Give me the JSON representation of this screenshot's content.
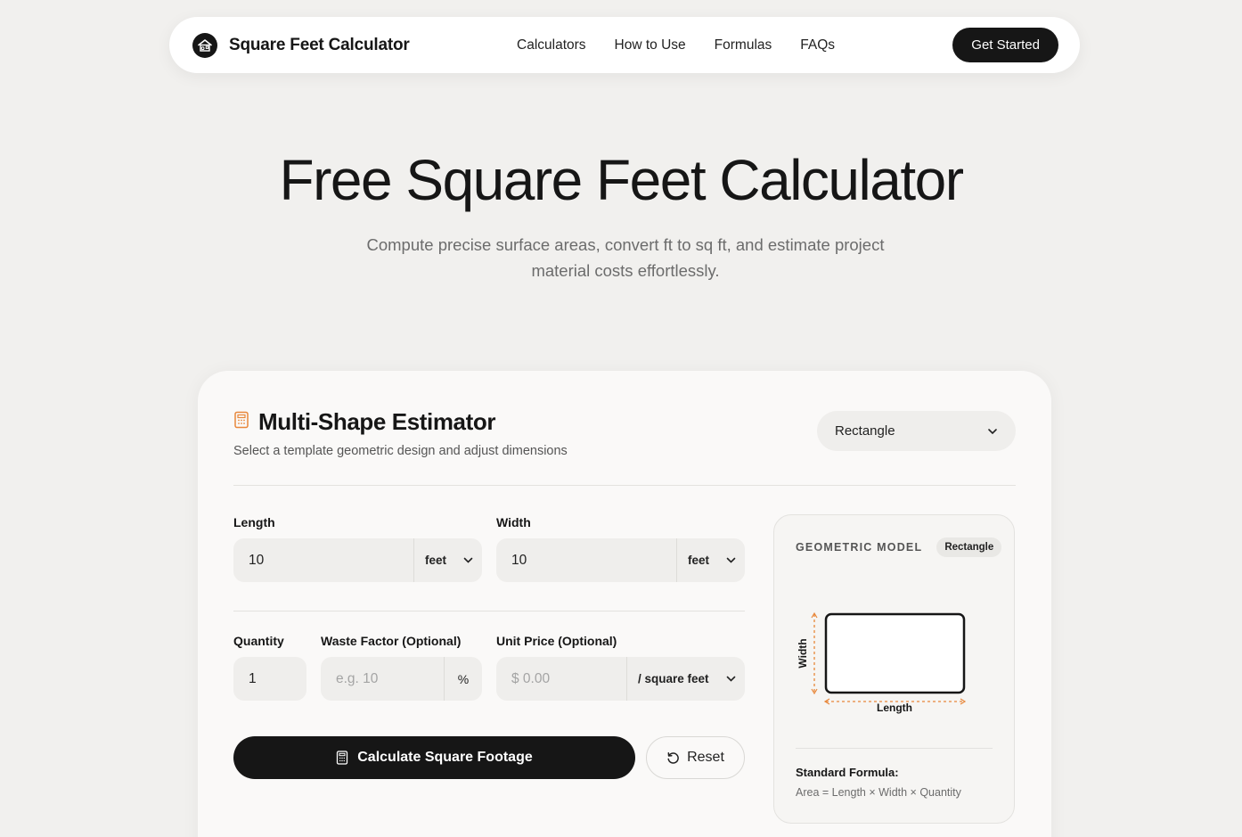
{
  "nav": {
    "brand": "Square Feet Calculator",
    "links": [
      "Calculators",
      "How to Use",
      "Formulas",
      "FAQs"
    ],
    "cta": "Get Started"
  },
  "hero": {
    "title": "Free Square Feet Calculator",
    "subtitle_line1": "Compute precise surface areas, convert ft to sq ft, and estimate project",
    "subtitle_line2": "material costs effortlessly."
  },
  "estimator": {
    "title": "Multi-Shape Estimator",
    "subtitle": "Select a template geometric design and adjust dimensions",
    "shape_selected": "Rectangle",
    "length": {
      "label": "Length",
      "value": "10",
      "unit": "feet"
    },
    "width": {
      "label": "Width",
      "value": "10",
      "unit": "feet"
    },
    "quantity": {
      "label": "Quantity",
      "value": "1"
    },
    "waste": {
      "label": "Waste Factor (Optional)",
      "placeholder": "e.g. 10",
      "unit": "%"
    },
    "price": {
      "label": "Unit Price (Optional)",
      "placeholder": "$ 0.00",
      "unit": "/ square feet"
    },
    "calculate_label": "Calculate Square Footage",
    "reset_label": "Reset"
  },
  "model": {
    "title": "GEOMETRIC MODEL",
    "badge": "Rectangle",
    "width_label": "Width",
    "length_label": "Length",
    "formula_label": "Standard Formula:",
    "formula_text": "Area = Length × Width × Quantity"
  },
  "colors": {
    "background": "#f1f0ee",
    "primary": "#161616",
    "accent_orange": "#e8873a"
  }
}
